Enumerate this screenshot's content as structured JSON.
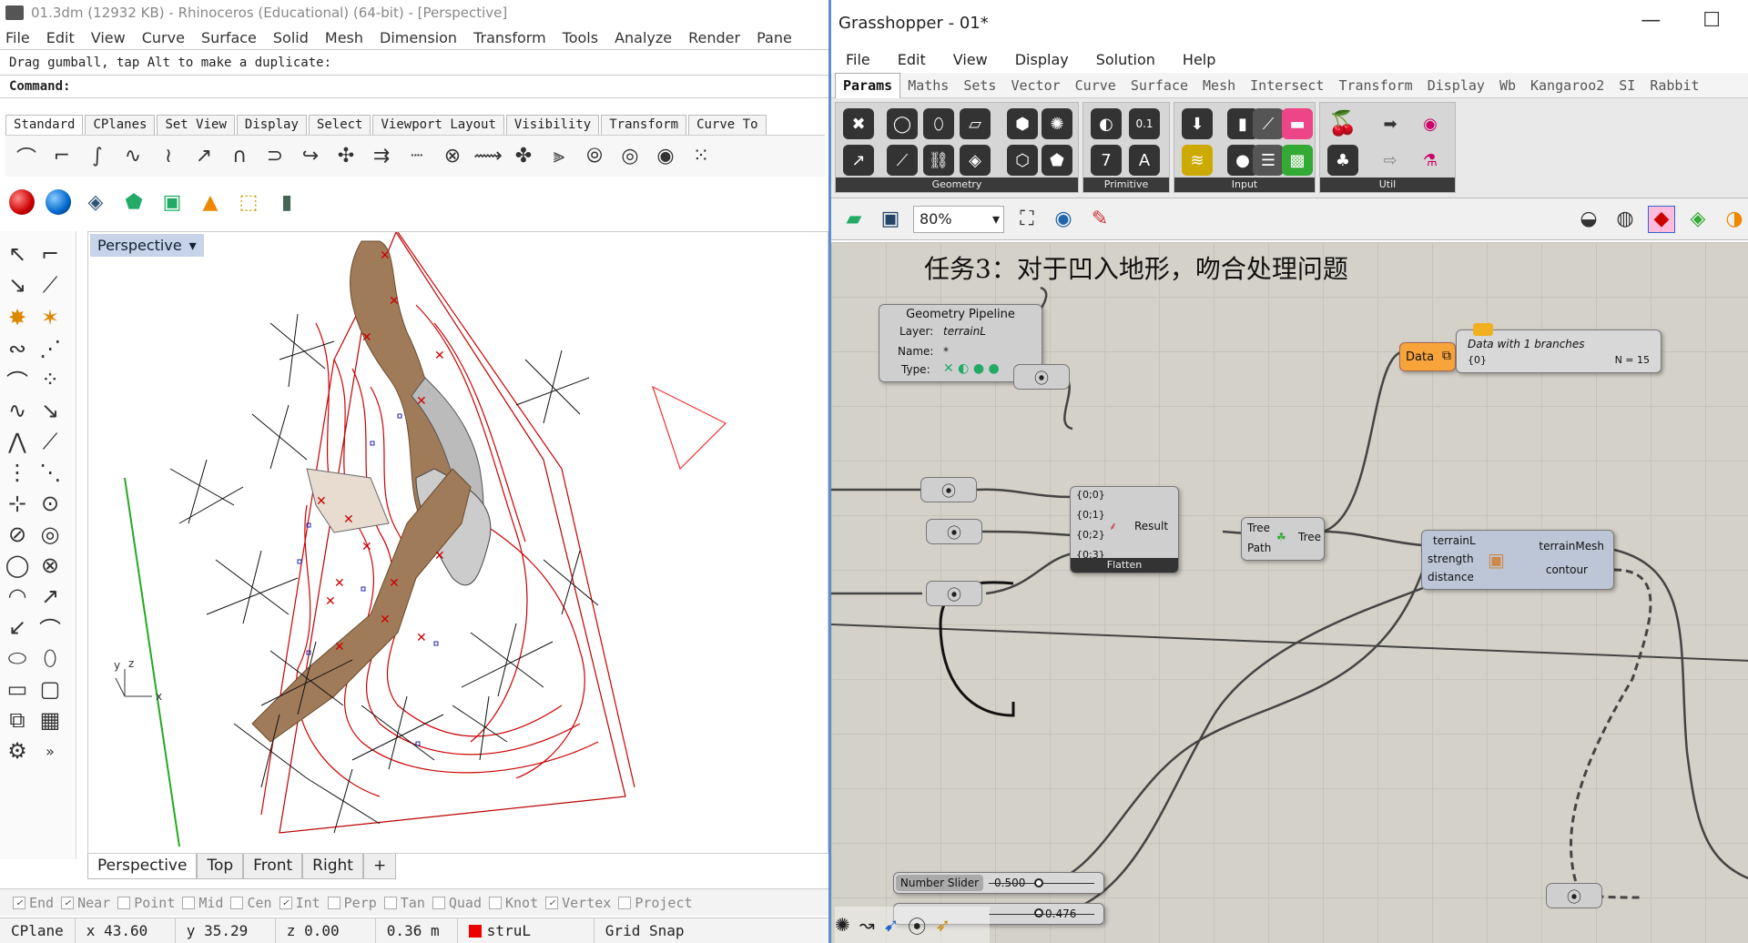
{
  "rhino": {
    "title": "01.3dm (12932 KB) - Rhinoceros (Educational) (64-bit) - [Perspective]",
    "menu": [
      "File",
      "Edit",
      "View",
      "Curve",
      "Surface",
      "Solid",
      "Mesh",
      "Dimension",
      "Transform",
      "Tools",
      "Analyze",
      "Render",
      "Pane"
    ],
    "command_history": "Drag gumball, tap Alt to make a duplicate:",
    "command_label": "Command:",
    "toolbar_tabs": [
      "Standard",
      "CPlanes",
      "Set View",
      "Display",
      "Select",
      "Viewport Layout",
      "Visibility",
      "Transform",
      "Curve To"
    ],
    "viewport_label": "Perspective",
    "viewport_tabs": [
      "Perspective",
      "Top",
      "Front",
      "Right",
      "+"
    ],
    "osnaps": [
      {
        "label": "End",
        "checked": true
      },
      {
        "label": "Near",
        "checked": true
      },
      {
        "label": "Point",
        "checked": false
      },
      {
        "label": "Mid",
        "checked": false
      },
      {
        "label": "Cen",
        "checked": false
      },
      {
        "label": "Int",
        "checked": true
      },
      {
        "label": "Perp",
        "checked": false
      },
      {
        "label": "Tan",
        "checked": false
      },
      {
        "label": "Quad",
        "checked": false
      },
      {
        "label": "Knot",
        "checked": false
      },
      {
        "label": "Vertex",
        "checked": true
      },
      {
        "label": "Project",
        "checked": false
      }
    ],
    "status": {
      "cplane": "CPlane",
      "x": "x 43.60",
      "y": "y 35.29",
      "z": "z 0.00",
      "unit": "0.36 m",
      "layer": "struL",
      "grid": "Grid Snap"
    },
    "axis": {
      "y": "y",
      "z": "z",
      "x": "x"
    }
  },
  "grasshopper": {
    "title": "Grasshopper - 01*",
    "window_controls": [
      "—",
      "☐"
    ],
    "menu": [
      "File",
      "Edit",
      "View",
      "Display",
      "Solution",
      "Help"
    ],
    "tabs": [
      "Params",
      "Maths",
      "Sets",
      "Vector",
      "Curve",
      "Surface",
      "Mesh",
      "Intersect",
      "Transform",
      "Display",
      "Wb",
      "Kangaroo2",
      "SI",
      "Rabbit"
    ],
    "groups": [
      "Geometry",
      "Primitive",
      "Input",
      "Util"
    ],
    "zoom": "80%",
    "note": "任务3：对于凹入地形，吻合处理问题",
    "pipeline": {
      "title": "Geometry Pipeline",
      "layer_label": "Layer:",
      "layer": "terrainL",
      "name_label": "Name:",
      "name": "*",
      "type_label": "Type:"
    },
    "flatten": {
      "inputs": [
        "{0;0}",
        "{0;1}",
        "{0;2}",
        "{0;3}"
      ],
      "output": "Result",
      "label": "Flatten"
    },
    "tree": {
      "inputs": [
        "Tree",
        "Path"
      ],
      "output": "Tree"
    },
    "data": {
      "label": "Data",
      "text": "Data with 1 branches",
      "path": "{0}",
      "count": "N = 15"
    },
    "cluster": {
      "inputs": [
        "terrainL",
        "strength",
        "distance"
      ],
      "outputs": [
        "terrainMesh",
        "contour"
      ]
    },
    "slider1": {
      "label": "Number Slider",
      "value": "0.500"
    },
    "slider2": {
      "value": "0.476"
    }
  }
}
